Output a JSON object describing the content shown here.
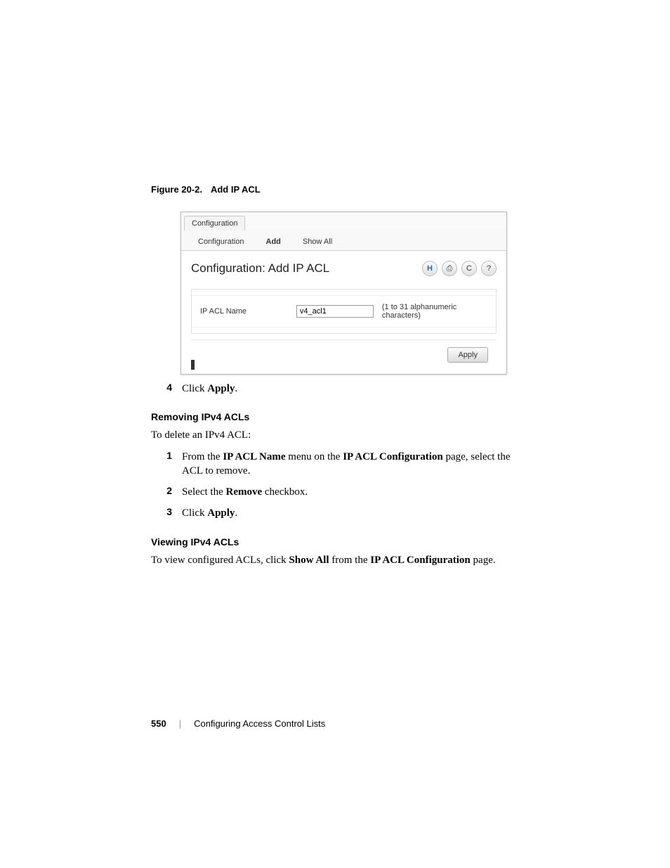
{
  "figure": {
    "label": "Figure 20-2.",
    "title": "Add IP ACL"
  },
  "screenshot": {
    "main_tab": "Configuration",
    "subtabs": {
      "config": "Configuration",
      "add": "Add",
      "showall": "Show All"
    },
    "heading": "Configuration: Add IP ACL",
    "icons": {
      "save": "H",
      "print": "⎙",
      "refresh": "C",
      "help": "?"
    },
    "field_label": "IP ACL Name",
    "field_value": "v4_acl1",
    "field_hint": "(1 to 31 alphanumeric characters)",
    "apply": "Apply"
  },
  "step4": {
    "num": "4",
    "prefix": "Click ",
    "bold": "Apply",
    "suffix": "."
  },
  "removing": {
    "heading": "Removing IPv4 ACLs",
    "intro": "To delete an IPv4 ACL:",
    "s1": {
      "num": "1",
      "p1": "From the ",
      "b1": "IP ACL Name",
      "p2": " menu on the ",
      "b2": "IP ACL Configuration",
      "p3": " page, select the ACL to remove."
    },
    "s2": {
      "num": "2",
      "p1": "Select the ",
      "b1": "Remove",
      "p2": " checkbox."
    },
    "s3": {
      "num": "3",
      "p1": "Click ",
      "b1": "Apply",
      "p2": "."
    }
  },
  "viewing": {
    "heading": "Viewing IPv4 ACLs",
    "p1": "To view configured ACLs, click ",
    "b1": "Show All",
    "p2": " from the ",
    "b2": "IP ACL Configuration",
    "p3": " page."
  },
  "footer": {
    "page": "550",
    "sep": "|",
    "title": "Configuring Access Control Lists"
  }
}
